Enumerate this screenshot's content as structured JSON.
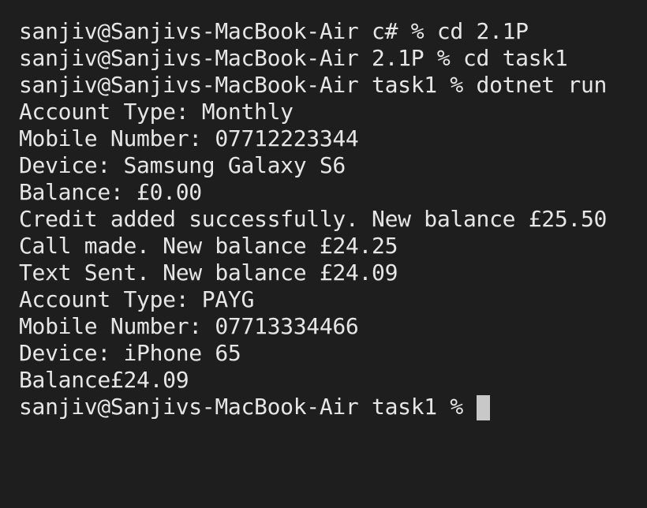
{
  "terminal": {
    "lines": [
      "sanjiv@Sanjivs-MacBook-Air c# % cd 2.1P",
      "sanjiv@Sanjivs-MacBook-Air 2.1P % cd task1",
      "sanjiv@Sanjivs-MacBook-Air task1 % dotnet run",
      "Account Type: Monthly",
      "Mobile Number: 07712223344",
      "Device: Samsung Galaxy S6",
      "Balance: £0.00",
      "Credit added successfully. New balance £25.50",
      "Call made. New balance £24.25",
      "Text Sent. New balance £24.09",
      "Account Type: PAYG",
      "Mobile Number: 07713334466",
      "Device: iPhone 65",
      "Balance£24.09"
    ],
    "current_prompt": "sanjiv@Sanjivs-MacBook-Air task1 %"
  },
  "colors": {
    "background": "#1e1e1e",
    "text": "#e6e6e6",
    "cursor": "#c8c8c8"
  }
}
